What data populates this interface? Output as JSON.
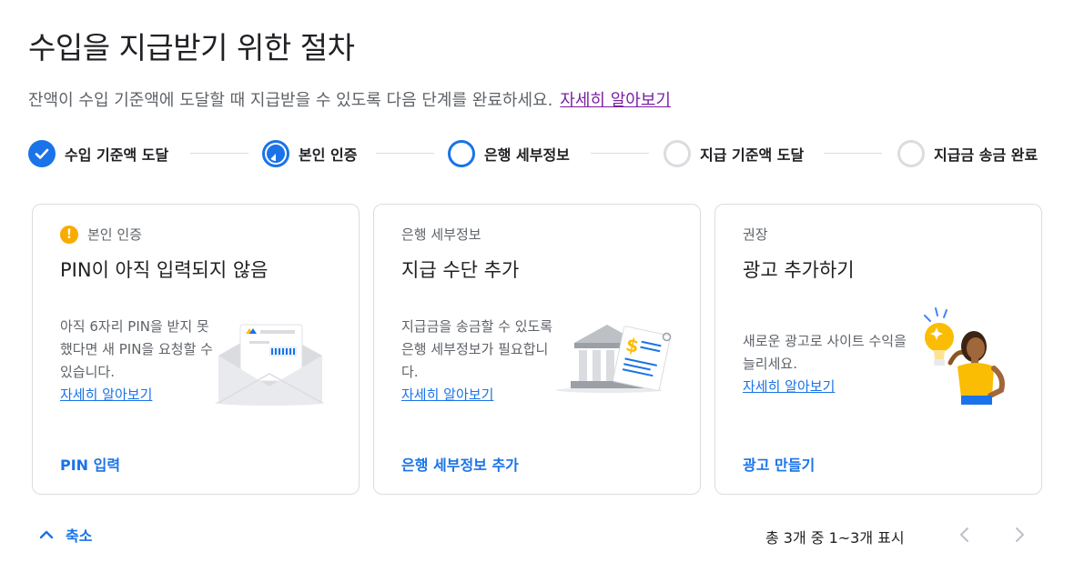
{
  "header": {
    "title": "수입을 지급받기 위한 절차",
    "subtitle": "잔액이 수입 기준액에 도달할 때 지급받을 수 있도록 다음 단계를 완료하세요.",
    "learn_more": "자세히 알아보기"
  },
  "steps": [
    {
      "label": "수입 기준액 도달",
      "state": "done"
    },
    {
      "label": "본인 인증",
      "state": "in-progress"
    },
    {
      "label": "은행 세부정보",
      "state": "current"
    },
    {
      "label": "지급 기준액 도달",
      "state": "pending"
    },
    {
      "label": "지급금 송금 완료",
      "state": "pending"
    }
  ],
  "cards": [
    {
      "kicker": "본인 인증",
      "kicker_icon": "warning-icon",
      "title": "PIN이 아직 입력되지 않음",
      "body": "아직 6자리 PIN을 받지 못했다면 새 PIN을 요청할 수 있습니다.",
      "link": "자세히 알아보기",
      "action": "PIN 입력",
      "illustration": "envelope-icon"
    },
    {
      "kicker": "은행 세부정보",
      "title": "지급 수단 추가",
      "body": "지급금을 송금할 수 있도록 은행 세부정보가 필요합니다.",
      "link": "자세히 알아보기",
      "action": "은행 세부정보 추가",
      "illustration": "bank-icon"
    },
    {
      "kicker": "권장",
      "title": "광고 추가하기",
      "body": "새로운 광고로 사이트 수익을 늘리세요.",
      "link": "자세히 알아보기",
      "action": "광고 만들기",
      "illustration": "woman-lightbulb-icon"
    }
  ],
  "footer": {
    "collapse_label": "축소",
    "pagination": "총 3개 중 1~3개 표시"
  },
  "colors": {
    "accent": "#1a73e8",
    "link_visited": "#7b1fa2",
    "warning": "#f9ab00",
    "border": "#dadce0"
  }
}
